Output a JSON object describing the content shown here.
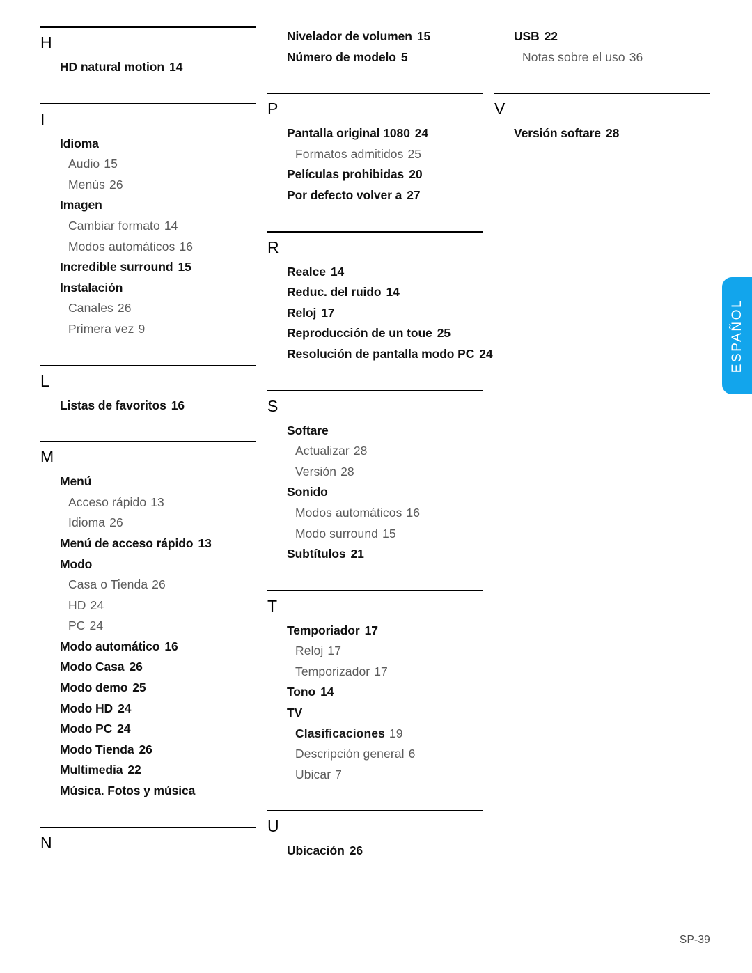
{
  "footer": {
    "page_label": "SP-39"
  },
  "side_tab": {
    "label": "ESPAÑOL",
    "color": "#12a5ec",
    "text_color": "#ffffff"
  },
  "columns": [
    {
      "sections": [
        {
          "letter": "H",
          "rule": true,
          "entries": [
            {
              "level": 1,
              "label": "HD natural motion",
              "page": "14"
            }
          ]
        },
        {
          "letter": "I",
          "rule": true,
          "entries": [
            {
              "level": 1,
              "label": "Idioma",
              "page": ""
            },
            {
              "level": 2,
              "label": "Audio",
              "page": "15"
            },
            {
              "level": 2,
              "label": "Menús",
              "page": "26"
            },
            {
              "level": 1,
              "label": "Imagen",
              "page": ""
            },
            {
              "level": 2,
              "label": "Cambiar formato",
              "page": "14"
            },
            {
              "level": 2,
              "label": "Modos automáticos",
              "page": "16"
            },
            {
              "level": 1,
              "label": "Incredible surround",
              "page": "15"
            },
            {
              "level": 1,
              "label": "Instalación",
              "page": ""
            },
            {
              "level": 2,
              "label": "Canales",
              "page": "26"
            },
            {
              "level": 2,
              "label": "Primera vez",
              "page": "9"
            }
          ]
        },
        {
          "letter": "L",
          "rule": true,
          "entries": [
            {
              "level": 1,
              "label": "Listas de favoritos",
              "page": "16"
            }
          ]
        },
        {
          "letter": "M",
          "rule": true,
          "entries": [
            {
              "level": 1,
              "label": "Menú",
              "page": ""
            },
            {
              "level": 2,
              "label": "Acceso rápido",
              "page": "13"
            },
            {
              "level": 2,
              "label": "Idioma",
              "page": "26"
            },
            {
              "level": 1,
              "label": "Menú de acceso rápido",
              "page": "13"
            },
            {
              "level": 1,
              "label": "Modo",
              "page": ""
            },
            {
              "level": 2,
              "label": "Casa o Tienda",
              "page": "26"
            },
            {
              "level": 2,
              "label": "HD",
              "page": "24"
            },
            {
              "level": 2,
              "label": "PC",
              "page": "24"
            },
            {
              "level": 1,
              "label": "Modo automático",
              "page": "16"
            },
            {
              "level": 1,
              "label": "Modo Casa",
              "page": "26"
            },
            {
              "level": 1,
              "label": "Modo demo",
              "page": "25"
            },
            {
              "level": 1,
              "label": "Modo HD",
              "page": "24"
            },
            {
              "level": 1,
              "label": "Modo PC",
              "page": "24"
            },
            {
              "level": 1,
              "label": "Modo Tienda",
              "page": "26"
            },
            {
              "level": 1,
              "label": "Multimedia",
              "page": "22"
            },
            {
              "level": 1,
              "label": "Música.  Fotos y música",
              "page": ""
            }
          ]
        },
        {
          "letter": "N",
          "rule": true,
          "entries": []
        }
      ]
    },
    {
      "sections": [
        {
          "letter": "",
          "rule": false,
          "entries": [
            {
              "level": 1,
              "label": "Nivelador de volumen",
              "page": "15"
            },
            {
              "level": 1,
              "label": "Número de modelo",
              "page": "5"
            }
          ]
        },
        {
          "letter": "P",
          "rule": true,
          "entries": [
            {
              "level": 1,
              "label": "Pantalla original 1080",
              "page": "24"
            },
            {
              "level": 2,
              "label": "Formatos admitidos",
              "page": "25"
            },
            {
              "level": 1,
              "label": "Películas prohibidas",
              "page": "20"
            },
            {
              "level": 1,
              "label": "Por defecto volver a",
              "page": "27"
            }
          ]
        },
        {
          "letter": "R",
          "rule": true,
          "entries": [
            {
              "level": 1,
              "label": "Realce",
              "page": "14"
            },
            {
              "level": 1,
              "label": "Reduc. del ruido",
              "page": "14"
            },
            {
              "level": 1,
              "label": "Reloj",
              "page": "17"
            },
            {
              "level": 1,
              "label": "Reproducción de un toue",
              "page": "25"
            },
            {
              "level": 1,
              "label": "Resolución de pantalla modo PC",
              "page": "24"
            }
          ]
        },
        {
          "letter": "S",
          "rule": true,
          "entries": [
            {
              "level": 1,
              "label": "Softare",
              "page": ""
            },
            {
              "level": 2,
              "label": "Actualizar",
              "page": "28"
            },
            {
              "level": 2,
              "label": "Versión",
              "page": "28"
            },
            {
              "level": 1,
              "label": "Sonido",
              "page": ""
            },
            {
              "level": 2,
              "label": "Modos automáticos",
              "page": "16"
            },
            {
              "level": 2,
              "label": "Modo surround",
              "page": "15"
            },
            {
              "level": 1,
              "label": "Subtítulos",
              "page": "21"
            }
          ]
        },
        {
          "letter": "T",
          "rule": true,
          "entries": [
            {
              "level": 1,
              "label": "Temporiador",
              "page": "17"
            },
            {
              "level": 2,
              "label": "Reloj",
              "page": "17"
            },
            {
              "level": 2,
              "label": "Temporizador",
              "page": "17"
            },
            {
              "level": 1,
              "label": "Tono",
              "page": "14"
            },
            {
              "level": 1,
              "label": "TV",
              "page": ""
            },
            {
              "level": "2em",
              "label": "Clasificaciones",
              "page": "19"
            },
            {
              "level": 2,
              "label": "Descripción general",
              "page": "6"
            },
            {
              "level": 2,
              "label": "Ubicar",
              "page": "7"
            }
          ]
        },
        {
          "letter": "U",
          "rule": true,
          "entries": [
            {
              "level": 1,
              "label": "Ubicación",
              "page": "26"
            }
          ]
        }
      ]
    },
    {
      "sections": [
        {
          "letter": "",
          "rule": false,
          "entries": [
            {
              "level": 1,
              "label": "USB",
              "page": "22"
            },
            {
              "level": 2,
              "label": "Notas sobre el uso",
              "page": "36"
            }
          ]
        },
        {
          "letter": "V",
          "rule": true,
          "entries": [
            {
              "level": 1,
              "label": "Versión softare",
              "page": "28"
            }
          ]
        }
      ]
    }
  ]
}
